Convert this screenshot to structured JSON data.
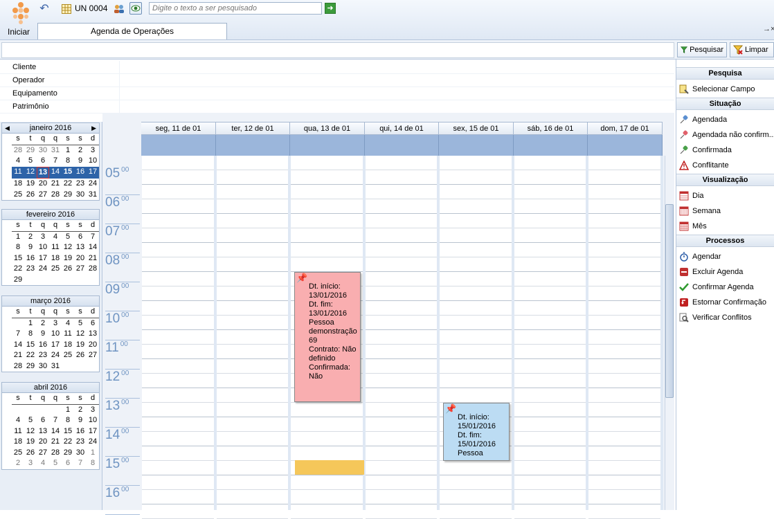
{
  "toolbar": {
    "start_label": "Iniciar",
    "unit_label": "UN 0004",
    "search_placeholder": "Digite o texto a ser pesquisado",
    "tab_label": "Agenda de Operações",
    "pin_glyph": "→×"
  },
  "filter": {
    "search_btn": "Pesquisar",
    "clear_btn": "Limpar",
    "fields": [
      "Cliente",
      "Operador",
      "Equipamento",
      "Patrimônio"
    ]
  },
  "calendar": {
    "months": [
      {
        "title": "janeiro 2016",
        "nav": true,
        "weeks": [
          [
            "28",
            "29",
            "30",
            "31",
            "1",
            "2",
            "3"
          ],
          [
            "4",
            "5",
            "6",
            "7",
            "8",
            "9",
            "10"
          ],
          [
            "11",
            "12",
            "13",
            "14",
            "15",
            "16",
            "17"
          ],
          [
            "18",
            "19",
            "20",
            "21",
            "22",
            "23",
            "24"
          ],
          [
            "25",
            "26",
            "27",
            "28",
            "29",
            "30",
            "31"
          ]
        ]
      },
      {
        "title": "fevereiro 2016",
        "weeks": [
          [
            "1",
            "2",
            "3",
            "4",
            "5",
            "6",
            "7"
          ],
          [
            "8",
            "9",
            "10",
            "11",
            "12",
            "13",
            "14"
          ],
          [
            "15",
            "16",
            "17",
            "18",
            "19",
            "20",
            "21"
          ],
          [
            "22",
            "23",
            "24",
            "25",
            "26",
            "27",
            "28"
          ],
          [
            "29",
            "",
            "",
            "",
            "",
            "",
            ""
          ]
        ]
      },
      {
        "title": "março 2016",
        "weeks": [
          [
            "",
            "1",
            "2",
            "3",
            "4",
            "5",
            "6"
          ],
          [
            "7",
            "8",
            "9",
            "10",
            "11",
            "12",
            "13"
          ],
          [
            "14",
            "15",
            "16",
            "17",
            "18",
            "19",
            "20"
          ],
          [
            "21",
            "22",
            "23",
            "24",
            "25",
            "26",
            "27"
          ],
          [
            "28",
            "29",
            "30",
            "31",
            "",
            "",
            ""
          ]
        ]
      },
      {
        "title": "abril 2016",
        "weeks": [
          [
            "",
            "",
            "",
            "",
            "",
            "1",
            "2",
            "3"
          ],
          [
            "4",
            "5",
            "6",
            "7",
            "8",
            "9",
            "10"
          ],
          [
            "11",
            "12",
            "13",
            "14",
            "15",
            "16",
            "17"
          ],
          [
            "18",
            "19",
            "20",
            "21",
            "22",
            "23",
            "24"
          ],
          [
            "25",
            "26",
            "27",
            "28",
            "29",
            "30",
            "1"
          ],
          [
            "2",
            "3",
            "4",
            "5",
            "6",
            "7",
            "8"
          ]
        ]
      }
    ],
    "day_names": [
      "s",
      "t",
      "q",
      "q",
      "s",
      "s",
      "d"
    ]
  },
  "schedule": {
    "days": [
      "seg, 11 de 01",
      "ter, 12 de 01",
      "qua, 13 de 01",
      "qui, 14 de 01",
      "sex, 15 de 01",
      "sáb, 16 de 01",
      "dom, 17 de 01"
    ],
    "hours": [
      "05",
      "06",
      "07",
      "08",
      "09",
      "10",
      "11",
      "12",
      "13",
      "14",
      "15",
      "16"
    ],
    "minutes": "00",
    "appointments": [
      {
        "lines": [
          "Dt. início:",
          "13/01/2016",
          "Dt. fim:",
          "13/01/2016",
          "Pessoa",
          "demonstração",
          "69",
          "Contrato: Não",
          "definido",
          "Confirmada:",
          "Não"
        ],
        "color": "#f9aeb0"
      },
      {
        "lines": [
          "Dt. início:",
          "15/01/2016",
          "Dt. fim:",
          "15/01/2016",
          "Pessoa"
        ],
        "color": "#bcdcf3"
      }
    ]
  },
  "sidebar": {
    "sections": [
      {
        "title": "Pesquisa",
        "items": [
          {
            "label": "Selecionar Campo",
            "icon": "select-field-icon"
          }
        ]
      },
      {
        "title": "Situação",
        "items": [
          {
            "label": "Agendada",
            "icon": "scheduled-pin-icon"
          },
          {
            "label": "Agendada não confirm...",
            "icon": "unconfirmed-pin-icon"
          },
          {
            "label": "Confirmada",
            "icon": "confirmed-pin-icon"
          },
          {
            "label": "Conflitante",
            "icon": "warning-icon"
          }
        ]
      },
      {
        "title": "Visualização",
        "items": [
          {
            "label": "Dia",
            "icon": "calendar-day-icon"
          },
          {
            "label": "Semana",
            "icon": "calendar-week-icon"
          },
          {
            "label": "Mês",
            "icon": "calendar-month-icon"
          }
        ]
      },
      {
        "title": "Processos",
        "items": [
          {
            "label": "Agendar",
            "icon": "stopwatch-icon"
          },
          {
            "label": "Excluir Agenda",
            "icon": "delete-icon"
          },
          {
            "label": "Confirmar Agenda",
            "icon": "check-icon"
          },
          {
            "label": "Estornar Confirmação",
            "icon": "undo-icon"
          },
          {
            "label": "Verificar Conflitos",
            "icon": "inspect-icon"
          }
        ]
      }
    ]
  }
}
